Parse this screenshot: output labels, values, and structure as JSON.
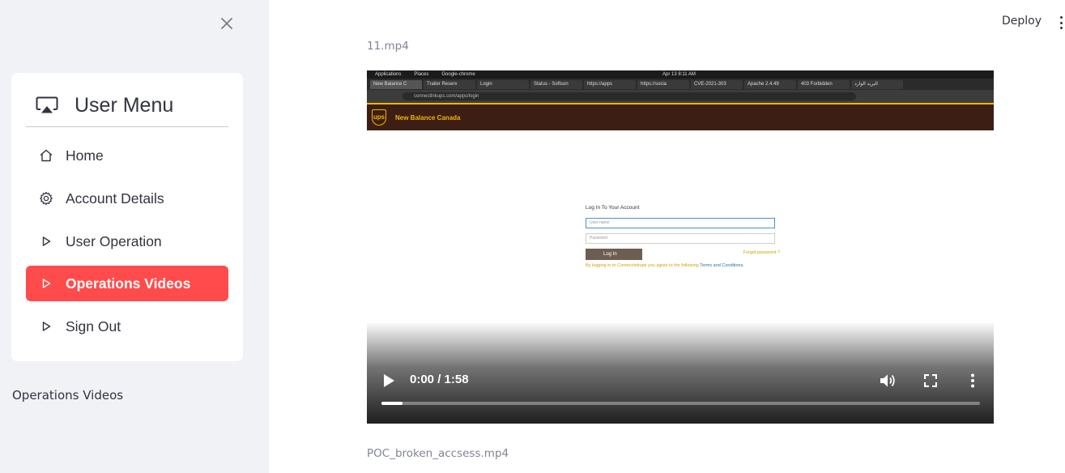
{
  "sidebar": {
    "menu_title": "User Menu",
    "items": [
      {
        "label": "Home",
        "icon": "house-icon",
        "active": false
      },
      {
        "label": "Account Details",
        "icon": "gear-icon",
        "active": false
      },
      {
        "label": "User Operation",
        "icon": "play-outline-icon",
        "active": false
      },
      {
        "label": "Operations Videos",
        "icon": "play-outline-icon",
        "active": true
      },
      {
        "label": "Sign Out",
        "icon": "play-outline-icon",
        "active": false
      }
    ],
    "caption": "Operations Videos",
    "active_color": "#ff4b4b"
  },
  "header": {
    "deploy_label": "Deploy"
  },
  "main": {
    "videos": [
      {
        "filename": "11.mp4",
        "time_display": "0:00 / 1:58",
        "progress_fraction": 0.035,
        "frame": {
          "os_bar": {
            "applications": "Applications",
            "places": "Places",
            "app": "Google-chrome",
            "clock": "Apr 13  8:11 AM"
          },
          "tabs": [
            "New Balance C",
            "Trailer Reserv",
            "Login",
            "Status - Softson",
            "https://apps",
            "https://socia",
            "CVE-2021-303",
            "Apache 2.4.49",
            "403 Forbidden",
            "البريد الوارد"
          ],
          "address": "connectlnkups.com/apps/login",
          "site_title": "New Balance Canada",
          "logo_text": "ups",
          "login_title": "Log In To Your Account",
          "username_placeholder": "User name",
          "password_placeholder": "Password",
          "login_button": "Log In",
          "forgot_link": "Forgot password ?",
          "terms_text": "By logging in to Connectinkups you agree to the following",
          "terms_link": "Terms and Conditions."
        }
      },
      {
        "filename": "POC_broken_accsess.mp4"
      }
    ]
  }
}
